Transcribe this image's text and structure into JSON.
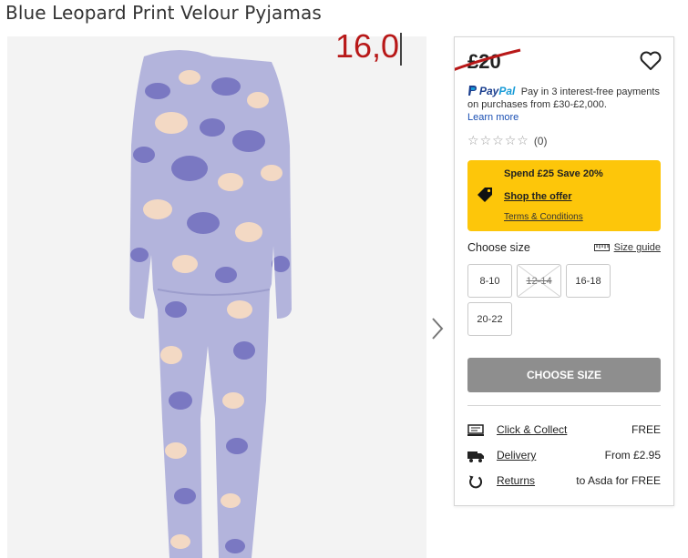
{
  "product": {
    "title": "Blue Leopard Print Velour Pyjamas",
    "handwritten_price": "16,0"
  },
  "price": {
    "current": "£20"
  },
  "paypal": {
    "logo_pay": "Pay",
    "logo_pal": "Pal",
    "text": "Pay in 3 interest-free payments on purchases from £30-£2,000.",
    "learn_more": "Learn more"
  },
  "rating": {
    "count": "(0)"
  },
  "offer": {
    "headline": "Spend £25 Save 20%",
    "shop_link": "Shop the offer",
    "terms_link": "Terms & Conditions"
  },
  "sizes": {
    "label": "Choose size",
    "guide": "Size guide",
    "options": [
      "8-10",
      "12-14",
      "16-18",
      "20-22"
    ],
    "unavailable": [
      "12-14"
    ]
  },
  "cta": {
    "label": "CHOOSE SIZE"
  },
  "delivery": [
    {
      "icon": "click-collect-icon",
      "label": "Click & Collect",
      "value": "FREE"
    },
    {
      "icon": "delivery-truck-icon",
      "label": "Delivery",
      "value": "From £2.95"
    },
    {
      "icon": "returns-icon",
      "label": "Returns",
      "value": "to Asda for FREE"
    }
  ],
  "colors": {
    "offer_bg": "#fdc60a",
    "cta_bg": "#8e8e8e",
    "handwritten": "#b81818",
    "link": "#1a4fb3",
    "pyjama_base": "#b3b4dc",
    "spot_dark": "#7a78c2",
    "spot_light": "#f3d9c4"
  }
}
